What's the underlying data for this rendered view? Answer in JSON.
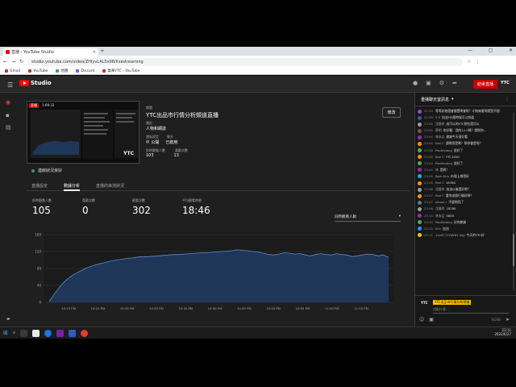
{
  "browser": {
    "tab_title": "直播 - YouTube Studio",
    "url": "studio.youtube.com/video/ZHlyvLAL5x98/livestreaming",
    "bookmarks": [
      "Gmail",
      "YouTube",
      "地圖",
      "Discord",
      "萬華YTC - YouTube"
    ]
  },
  "studio": {
    "logo_text": "Studio",
    "end_stream_label": "結束直播",
    "avatar_text": "YTC"
  },
  "stream": {
    "thumb_live": "直播",
    "thumb_duration": "1:09:33",
    "thumb_brand": "YTC",
    "section_label": "標題",
    "title": "YTC出品市行情分析頻道直播",
    "category_label": "類別",
    "category_value": "人物和網誌",
    "visibility_label": "隱私設定",
    "visibility_value": "公開",
    "chat_label": "聊天",
    "chat_value": "已啟用",
    "stat1_label": "即時觀看人數",
    "stat1_value": "103",
    "stat2_label": "喜歡次數",
    "stat2_value": "13",
    "edit_label": "修改",
    "connection_status": "連線狀況良好"
  },
  "tabs": [
    "直播設定",
    "數據分析",
    "直播的串流狀況"
  ],
  "active_tab": 1,
  "metrics": [
    {
      "label": "即時觀看人數",
      "value": "105"
    },
    {
      "label": "喜歡次數",
      "value": "0"
    },
    {
      "label": "觀看次數",
      "value": "302"
    },
    {
      "label": "平均觀看時間",
      "value": "18:46"
    }
  ],
  "metric_select": "同時觀看人數",
  "chart_data": {
    "type": "area",
    "title": "",
    "xlabel": "",
    "ylabel": "",
    "ylim": [
      0,
      160
    ],
    "yticks": [
      0,
      40,
      80,
      120,
      160
    ],
    "xticks": [
      "10:15 PM",
      "10:20 PM",
      "10:25 PM",
      "10:30 PM",
      "10:35 PM",
      "10:40 PM",
      "10:45 PM",
      "10:50 PM",
      "10:55 PM",
      "11:00 PM",
      "11:05 PM"
    ],
    "values": [
      2,
      20,
      36,
      50,
      60,
      68,
      74,
      80,
      85,
      89,
      92,
      95,
      98,
      100,
      102,
      104,
      105,
      107,
      108,
      108,
      109,
      110,
      111,
      112,
      113,
      113,
      114,
      115,
      116,
      117,
      117,
      118,
      119,
      120,
      121,
      122,
      124,
      123,
      122,
      120,
      119,
      116,
      113,
      112,
      114,
      117,
      116,
      114,
      115,
      112,
      110,
      113,
      115,
      113,
      112,
      115,
      113,
      112,
      108,
      110,
      112,
      114,
      113,
      110,
      112,
      106
    ],
    "fill_color": "#1e3658",
    "line_color": "#5c8fd0",
    "grid": true
  },
  "chat": {
    "header": "重播聊天室訊息",
    "messages": [
      {
        "t": "22:59",
        "a": "",
        "m": "等等其他還會閒置嗎會呢？才剛來看啊還是不錯",
        "c": "#9c4dcc"
      },
      {
        "t": "22:59",
        "a": "S S",
        "m": "加油?什麼時候可以知道",
        "c": "#3f51b5"
      },
      {
        "t": "23:00",
        "a": "沈昌祥",
        "m": "這可以的YTC那些還可以",
        "c": "#9e9e9e"
      },
      {
        "t": "23:00",
        "a": "蔡明",
        "m": "你好喔：我的12.0嗎？請問你...",
        "c": "#795548"
      },
      {
        "t": "23:00",
        "a": "林永吉",
        "m": "謝謝今天很好看",
        "c": "#9c27b0"
      },
      {
        "t": "23:00",
        "a": "feol C",
        "m": "請問您是嗎？那你會是呢？",
        "c": "#ff9800"
      },
      {
        "t": "23:00",
        "a": "Poohtsiang",
        "m": "很好了",
        "c": "#4caf50"
      },
      {
        "t": "23:00",
        "a": "feol C",
        "m": "YTC1900",
        "c": "#ff9800"
      },
      {
        "t": "23:04",
        "a": "Poohtsiang",
        "m": "很好了",
        "c": "#4caf50"
      },
      {
        "t": "23:04",
        "a": "林",
        "m": "是啊！",
        "c": "#9c27b0"
      },
      {
        "t": "23:06",
        "a": "Bom Kim",
        "m": "市場上哪得好",
        "c": "#00bcd4"
      },
      {
        "t": "23:06",
        "a": "feol C",
        "m": "18780",
        "c": "#ff9800"
      },
      {
        "t": "23:06",
        "a": "沈昌祥",
        "m": "加油以後還好吧？",
        "c": "#9e9e9e"
      },
      {
        "t": "23:07",
        "a": "feol C",
        "m": "看你這個行情好嗎？",
        "c": "#ff9800"
      },
      {
        "t": "23:07",
        "a": "simon r",
        "m": "不要問我了",
        "c": "#607d8b"
      },
      {
        "t": "23:08",
        "a": "沈昌祥",
        "m": "18780",
        "c": "#9e9e9e"
      },
      {
        "t": "23:10",
        "a": "林永吉",
        "m": "5800",
        "c": "#9c27b0"
      },
      {
        "t": "23:10",
        "a": "Poohtsiang",
        "m": "好的謝謝",
        "c": "#4caf50"
      },
      {
        "t": "23:10",
        "a": "Eric",
        "m": "加油",
        "c": "#2196f3"
      },
      {
        "t": "23:11",
        "a": "1ax0C7YGWNY JAyJ",
        "m": "今天的YTC好",
        "c": "#ffc107"
      }
    ],
    "input_name": "YTC出品市行情分析頻道",
    "input_placeholder": "說點什麼...",
    "char_count": "0/200"
  },
  "taskbar": {
    "time": "23:11",
    "date": "2022/6/27"
  }
}
